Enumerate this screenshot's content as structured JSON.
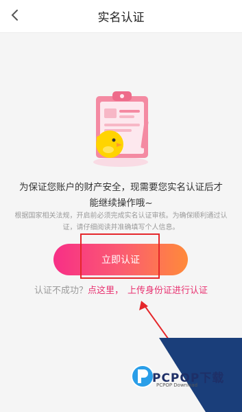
{
  "header": {
    "title": "实名认证",
    "back_icon": "chevron-left-icon"
  },
  "illustration": {
    "name": "clipboard-with-chick-illustration"
  },
  "description": "为保证您账户的财产安全，现需要您实名认证后才能继续操作哦~",
  "note": "根据国家相关法规，开启前必须完成实名认证审核。为确保顺利通过认证，请仔细阅读并准确填写个人信息。",
  "verify_button": {
    "label": "立即认证"
  },
  "help": {
    "question": "认证不成功？",
    "link1": "点这里，",
    "link2": "上传身份证进行认证"
  },
  "watermark": {
    "brand": "PCPOP下载",
    "sub": "PCPOP Download"
  },
  "colors": {
    "accent": "#e8306f",
    "button_gradient_start": "#f72f86",
    "button_gradient_end": "#ff8a3a",
    "annotation_red": "#e5262a"
  }
}
